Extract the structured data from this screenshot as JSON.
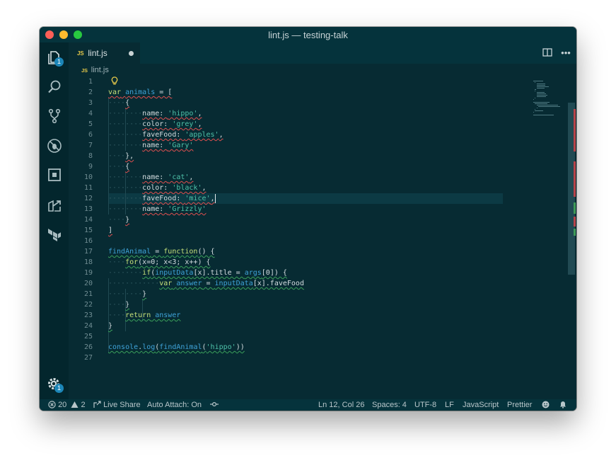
{
  "window": {
    "title": "lint.js — testing-talk"
  },
  "activity_bar": {
    "explorer_badge": "1",
    "settings_badge": "1",
    "items": [
      "files-icon",
      "search-icon",
      "source-control-icon",
      "debug-icon",
      "extensions-icon",
      "live-share-icon",
      "terraform-icon"
    ]
  },
  "tab": {
    "lang_badge": "JS",
    "label": "lint.js"
  },
  "breadcrumb": {
    "lang_badge": "JS",
    "file": "lint.js"
  },
  "editor": {
    "line_numbers": [
      "1",
      "2",
      "3",
      "4",
      "5",
      "6",
      "7",
      "8",
      "9",
      "10",
      "11",
      "12",
      "13",
      "14",
      "15",
      "16",
      "17",
      "18",
      "19",
      "20",
      "21",
      "22",
      "23",
      "24",
      "25",
      "26",
      "27"
    ],
    "code_lines": [
      "",
      "var animals = [",
      "    {",
      "        name: 'hippo',",
      "        color: 'grey',",
      "        faveFood: 'apples',",
      "        name: 'Gary'",
      "    },",
      "    {",
      "        name: 'cat',",
      "        color: 'black',",
      "        faveFood: 'mice',",
      "        name: 'Grizzly'",
      "    }",
      "]",
      "",
      "findAnimal = function() {",
      "    for(x=0; x<3; x++) {",
      "        if(inputData[x].title = args[0]) {",
      "            var answer = inputData[x].faveFood",
      "        }",
      "    }",
      "    return answer",
      "}",
      "",
      "console.log(findAnimal('hippo'))",
      ""
    ]
  },
  "status_bar": {
    "errors": "20",
    "warnings": "2",
    "live_share": "Live Share",
    "auto_attach": "Auto Attach: On",
    "position": "Ln 12, Col 26",
    "spaces": "Spaces: 4",
    "encoding": "UTF-8",
    "eol": "LF",
    "language": "JavaScript",
    "formatter": "Prettier"
  },
  "colors": {
    "background": "#072b33",
    "keyword": "#c5e07a",
    "identifier": "#3fa3d9",
    "string": "#4ec2a9",
    "error_squiggle": "#e04f4f",
    "warning_squiggle": "#3aa05a",
    "badge": "#1c86b8"
  }
}
